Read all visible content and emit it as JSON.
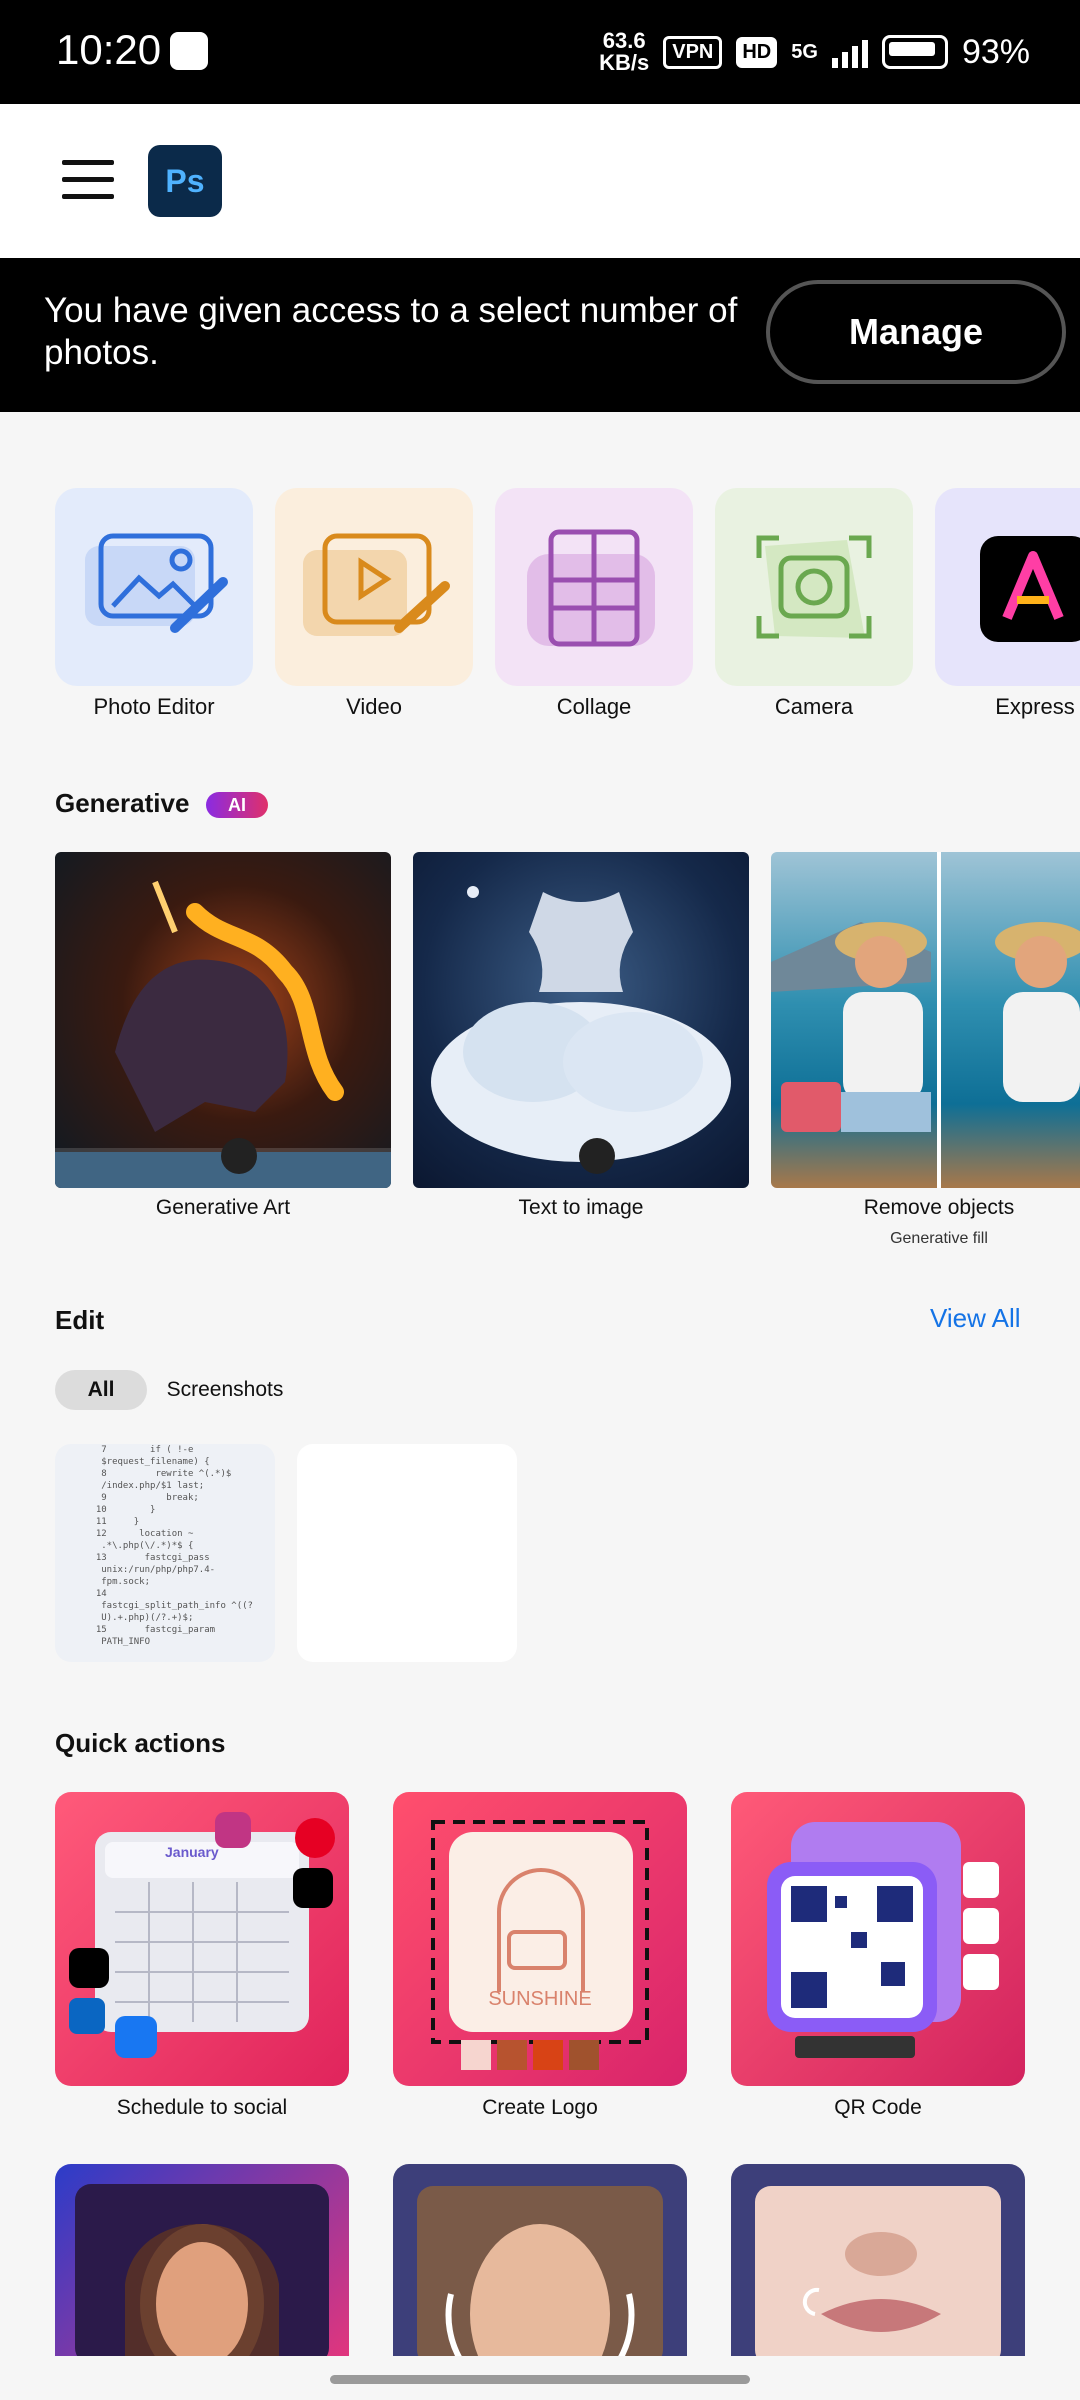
{
  "status": {
    "time": "10:20",
    "speed_top": "63.6",
    "speed_bottom": "KB/s",
    "vpn": "VPN",
    "hd": "HD",
    "network": "5G",
    "battery": "93%"
  },
  "banner": {
    "message": "You have given access to a select number of photos.",
    "manage": "Manage"
  },
  "logo_text": "Ps",
  "tools": [
    {
      "label": "Photo Editor",
      "color": "#e3ebfb"
    },
    {
      "label": "Video",
      "color": "#fbeedd"
    },
    {
      "label": "Collage",
      "color": "#f3e3f6"
    },
    {
      "label": "Camera",
      "color": "#e9f2e1"
    },
    {
      "label": "Express",
      "color": "#e6e4fb"
    }
  ],
  "generative": {
    "title": "Generative",
    "badge": "AI",
    "cards": [
      {
        "label": "Generative Art"
      },
      {
        "label": "Text to image"
      },
      {
        "label": "Remove objects",
        "sub": "Generative fill"
      }
    ]
  },
  "edit": {
    "title": "Edit",
    "view_all": "View All",
    "chips": [
      "All",
      "Screenshots"
    ],
    "code_snippet": "   7        if ( !-e\n   $request_filename) {\n   8         rewrite ^(.*)$\n   /index.php/$1 last;\n   9           break;\n  10        }\n  11     }\n  12      location ~\n   .*\\.php(\\/.*)*$ {\n  13       fastcgi_pass\n   unix:/run/php/php7.4-\n   fpm.sock;\n  14\n   fastcgi_split_path_info ^((?\n   U).+.php)(/?.+)$;\n  15       fastcgi_param\n   PATH_INFO"
  },
  "quick_actions": {
    "title": "Quick actions",
    "items": [
      {
        "label": "Schedule to social"
      },
      {
        "label": "Create Logo",
        "logo_word": "SUNSHINE"
      },
      {
        "label": "QR Code"
      }
    ],
    "calendar_month": "January"
  }
}
